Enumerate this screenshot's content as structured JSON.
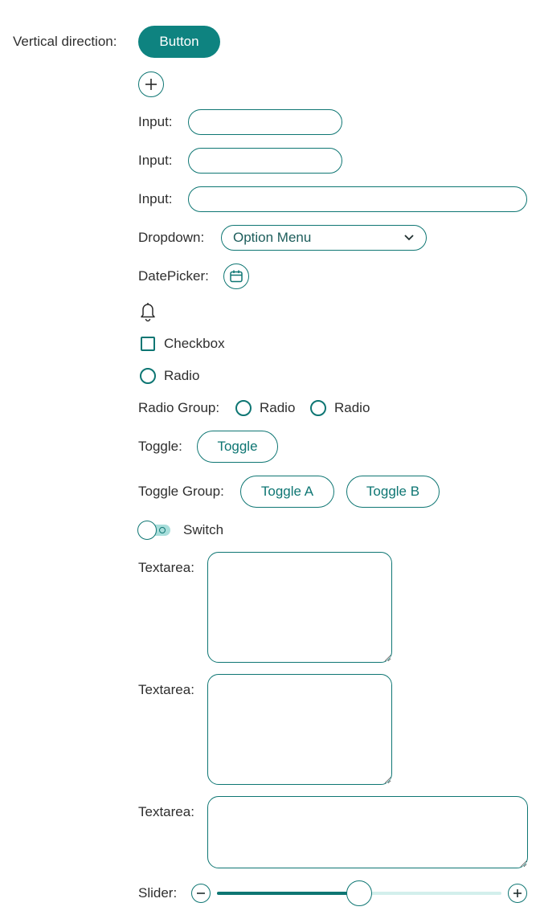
{
  "colors": {
    "accent": "#0e8380",
    "accent_dark": "#0e7673",
    "slider_track": "#d3efec",
    "switch_track": "#a8dedb"
  },
  "section": {
    "label": "Vertical direction:"
  },
  "button": {
    "label": "Button"
  },
  "add_button": {
    "icon": "plus-icon"
  },
  "inputs": [
    {
      "label": "Input:",
      "value": "",
      "placeholder": ""
    },
    {
      "label": "Input:",
      "value": "",
      "placeholder": ""
    },
    {
      "label": "Input:",
      "value": "",
      "placeholder": ""
    }
  ],
  "dropdown": {
    "label": "Dropdown:",
    "selected": "Option Menu",
    "icon": "chevron-down-icon"
  },
  "datepicker": {
    "label": "DatePicker:",
    "icon": "calendar-icon"
  },
  "notification": {
    "icon": "bell-icon"
  },
  "checkbox": {
    "label": "Checkbox",
    "checked": false
  },
  "radio": {
    "label": "Radio",
    "checked": false
  },
  "radio_group": {
    "label": "Radio Group:",
    "options": [
      "Radio",
      "Radio"
    ]
  },
  "toggle": {
    "label": "Toggle:",
    "button_label": "Toggle"
  },
  "toggle_group": {
    "label": "Toggle Group:",
    "options": [
      "Toggle A",
      "Toggle B"
    ]
  },
  "switch": {
    "label": "Switch",
    "on": false
  },
  "textareas": [
    {
      "label": "Textarea:",
      "value": ""
    },
    {
      "label": "Textarea:",
      "value": ""
    },
    {
      "label": "Textarea:",
      "value": ""
    }
  ],
  "slider": {
    "label": "Slider:",
    "value_fraction": 0.5,
    "decrease_icon": "minus-icon",
    "increase_icon": "plus-icon"
  }
}
